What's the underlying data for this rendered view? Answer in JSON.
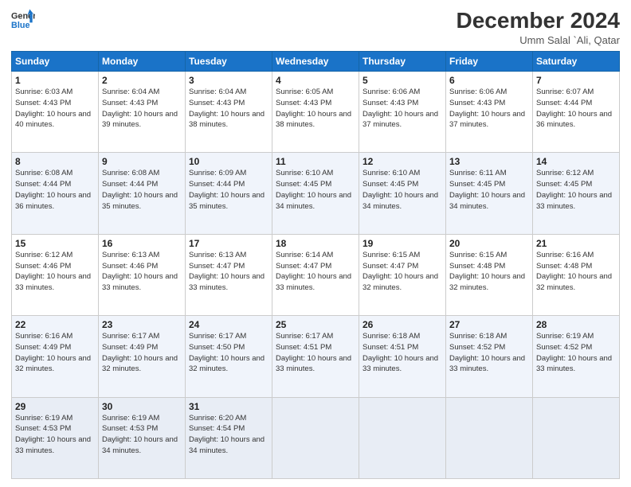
{
  "header": {
    "logo_line1": "General",
    "logo_line2": "Blue",
    "month": "December 2024",
    "location": "Umm Salal `Ali, Qatar"
  },
  "weekdays": [
    "Sunday",
    "Monday",
    "Tuesday",
    "Wednesday",
    "Thursday",
    "Friday",
    "Saturday"
  ],
  "weeks": [
    [
      {
        "day": "1",
        "sunrise": "6:03 AM",
        "sunset": "4:43 PM",
        "daylight": "10 hours and 40 minutes."
      },
      {
        "day": "2",
        "sunrise": "6:04 AM",
        "sunset": "4:43 PM",
        "daylight": "10 hours and 39 minutes."
      },
      {
        "day": "3",
        "sunrise": "6:04 AM",
        "sunset": "4:43 PM",
        "daylight": "10 hours and 38 minutes."
      },
      {
        "day": "4",
        "sunrise": "6:05 AM",
        "sunset": "4:43 PM",
        "daylight": "10 hours and 38 minutes."
      },
      {
        "day": "5",
        "sunrise": "6:06 AM",
        "sunset": "4:43 PM",
        "daylight": "10 hours and 37 minutes."
      },
      {
        "day": "6",
        "sunrise": "6:06 AM",
        "sunset": "4:43 PM",
        "daylight": "10 hours and 37 minutes."
      },
      {
        "day": "7",
        "sunrise": "6:07 AM",
        "sunset": "4:44 PM",
        "daylight": "10 hours and 36 minutes."
      }
    ],
    [
      {
        "day": "8",
        "sunrise": "6:08 AM",
        "sunset": "4:44 PM",
        "daylight": "10 hours and 36 minutes."
      },
      {
        "day": "9",
        "sunrise": "6:08 AM",
        "sunset": "4:44 PM",
        "daylight": "10 hours and 35 minutes."
      },
      {
        "day": "10",
        "sunrise": "6:09 AM",
        "sunset": "4:44 PM",
        "daylight": "10 hours and 35 minutes."
      },
      {
        "day": "11",
        "sunrise": "6:10 AM",
        "sunset": "4:45 PM",
        "daylight": "10 hours and 34 minutes."
      },
      {
        "day": "12",
        "sunrise": "6:10 AM",
        "sunset": "4:45 PM",
        "daylight": "10 hours and 34 minutes."
      },
      {
        "day": "13",
        "sunrise": "6:11 AM",
        "sunset": "4:45 PM",
        "daylight": "10 hours and 34 minutes."
      },
      {
        "day": "14",
        "sunrise": "6:12 AM",
        "sunset": "4:45 PM",
        "daylight": "10 hours and 33 minutes."
      }
    ],
    [
      {
        "day": "15",
        "sunrise": "6:12 AM",
        "sunset": "4:46 PM",
        "daylight": "10 hours and 33 minutes."
      },
      {
        "day": "16",
        "sunrise": "6:13 AM",
        "sunset": "4:46 PM",
        "daylight": "10 hours and 33 minutes."
      },
      {
        "day": "17",
        "sunrise": "6:13 AM",
        "sunset": "4:47 PM",
        "daylight": "10 hours and 33 minutes."
      },
      {
        "day": "18",
        "sunrise": "6:14 AM",
        "sunset": "4:47 PM",
        "daylight": "10 hours and 33 minutes."
      },
      {
        "day": "19",
        "sunrise": "6:15 AM",
        "sunset": "4:47 PM",
        "daylight": "10 hours and 32 minutes."
      },
      {
        "day": "20",
        "sunrise": "6:15 AM",
        "sunset": "4:48 PM",
        "daylight": "10 hours and 32 minutes."
      },
      {
        "day": "21",
        "sunrise": "6:16 AM",
        "sunset": "4:48 PM",
        "daylight": "10 hours and 32 minutes."
      }
    ],
    [
      {
        "day": "22",
        "sunrise": "6:16 AM",
        "sunset": "4:49 PM",
        "daylight": "10 hours and 32 minutes."
      },
      {
        "day": "23",
        "sunrise": "6:17 AM",
        "sunset": "4:49 PM",
        "daylight": "10 hours and 32 minutes."
      },
      {
        "day": "24",
        "sunrise": "6:17 AM",
        "sunset": "4:50 PM",
        "daylight": "10 hours and 32 minutes."
      },
      {
        "day": "25",
        "sunrise": "6:17 AM",
        "sunset": "4:51 PM",
        "daylight": "10 hours and 33 minutes."
      },
      {
        "day": "26",
        "sunrise": "6:18 AM",
        "sunset": "4:51 PM",
        "daylight": "10 hours and 33 minutes."
      },
      {
        "day": "27",
        "sunrise": "6:18 AM",
        "sunset": "4:52 PM",
        "daylight": "10 hours and 33 minutes."
      },
      {
        "day": "28",
        "sunrise": "6:19 AM",
        "sunset": "4:52 PM",
        "daylight": "10 hours and 33 minutes."
      }
    ],
    [
      {
        "day": "29",
        "sunrise": "6:19 AM",
        "sunset": "4:53 PM",
        "daylight": "10 hours and 33 minutes."
      },
      {
        "day": "30",
        "sunrise": "6:19 AM",
        "sunset": "4:53 PM",
        "daylight": "10 hours and 34 minutes."
      },
      {
        "day": "31",
        "sunrise": "6:20 AM",
        "sunset": "4:54 PM",
        "daylight": "10 hours and 34 minutes."
      },
      null,
      null,
      null,
      null
    ]
  ]
}
